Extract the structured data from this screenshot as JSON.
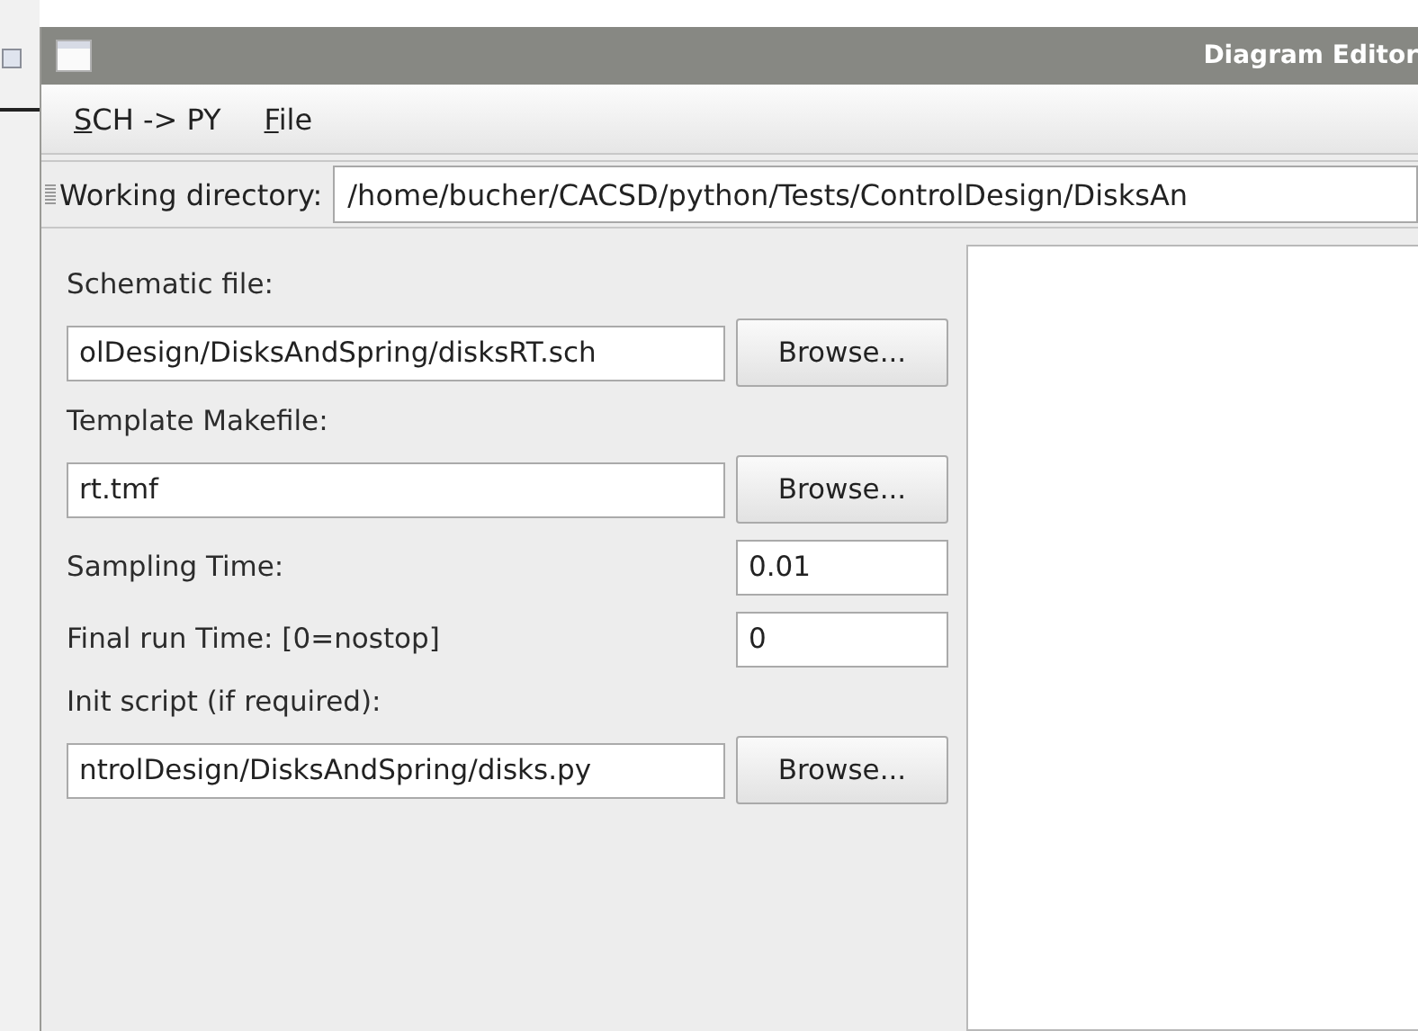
{
  "window": {
    "title": "Diagram Editor"
  },
  "menu": [
    {
      "label": "SCH -> PY",
      "mnemonic_underlined": true
    },
    {
      "label": "File",
      "mnemonic_underlined": true
    }
  ],
  "toolbar": {
    "label": "Working directory:",
    "value": "/home/bucher/CACSD/python/Tests/ControlDesign/DisksAn"
  },
  "form": [
    {
      "kind": "file",
      "label": "Schematic file:",
      "value": "olDesign/DisksAndSpring/disksRT.sch",
      "button": "Browse..."
    },
    {
      "kind": "file",
      "label": "Template Makefile:",
      "value": "rt.tmf",
      "button": "Browse..."
    },
    {
      "kind": "number",
      "label": "Sampling Time:",
      "value": "0.01"
    },
    {
      "kind": "number",
      "label": "Final run Time: [0=nostop]",
      "value": "0"
    },
    {
      "kind": "file",
      "label": "Init script (if required):",
      "value": "ntrolDesign/DisksAndSpring/disks.py",
      "button": "Browse..."
    }
  ]
}
